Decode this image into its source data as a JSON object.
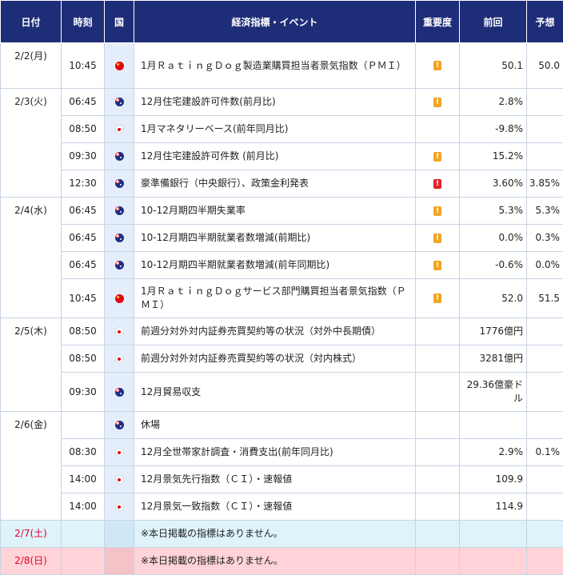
{
  "headers": {
    "date": "日付",
    "time": "時刻",
    "country": "国",
    "event": "経済指標・イベント",
    "importance": "重要度",
    "previous": "前回",
    "forecast": "予想"
  },
  "importance_mark": "!",
  "colors": {
    "header_bg": "#1e2d77",
    "saturday_bg": "#dff3fb",
    "sunday_bg": "#ffd3d7",
    "weekend_text": "#e0002a",
    "importance_mid": "#f2a423",
    "importance_high": "#e0222b"
  },
  "days": [
    {
      "date": "2/2(月)",
      "rows": [
        {
          "time": "10:45",
          "flag": "cn-flag-icon",
          "event": "1月ＲａｔｉｎｇＤｏｇ製造業購買担当者景気指数（ＰＭＩ）",
          "importance": "mid",
          "previous": "50.1",
          "forecast": "50.0",
          "tall": true
        }
      ]
    },
    {
      "date": "2/3(火)",
      "rows": [
        {
          "time": "06:45",
          "flag": "au-flag-icon",
          "event": "12月住宅建設許可件数(前月比)",
          "importance": "mid",
          "previous": "2.8%",
          "forecast": ""
        },
        {
          "time": "08:50",
          "flag": "jp-flag-icon",
          "event": "1月マネタリーベース(前年同月比)",
          "importance": "",
          "previous": "-9.8%",
          "forecast": ""
        },
        {
          "time": "09:30",
          "flag": "au-flag-icon",
          "event": "12月住宅建設許可件数 (前月比)",
          "importance": "mid",
          "previous": "15.2%",
          "forecast": ""
        },
        {
          "time": "12:30",
          "flag": "au-flag-icon",
          "event": "豪準備銀行（中央銀行）、政策金利発表",
          "importance": "high",
          "previous": "3.60%",
          "forecast": "3.85%"
        }
      ]
    },
    {
      "date": "2/4(水)",
      "rows": [
        {
          "time": "06:45",
          "flag": "au-flag-icon",
          "event": "10-12月期四半期失業率",
          "importance": "mid",
          "previous": "5.3%",
          "forecast": "5.3%"
        },
        {
          "time": "06:45",
          "flag": "au-flag-icon",
          "event": "10-12月期四半期就業者数増減(前期比)",
          "importance": "mid",
          "previous": "0.0%",
          "forecast": "0.3%"
        },
        {
          "time": "06:45",
          "flag": "au-flag-icon",
          "event": "10-12月期四半期就業者数増減(前年同期比)",
          "importance": "mid",
          "previous": "-0.6%",
          "forecast": "0.0%"
        },
        {
          "time": "10:45",
          "flag": "cn-flag-icon",
          "event": "1月ＲａｔｉｎｇＤｏｇサービス部門購買担当者景気指数（ＰＭＩ）",
          "importance": "mid",
          "previous": "52.0",
          "forecast": "51.5",
          "tall": true
        }
      ]
    },
    {
      "date": "2/5(木)",
      "rows": [
        {
          "time": "08:50",
          "flag": "jp-flag-icon",
          "event": "前週分対外対内証券売買契約等の状況（対外中長期債）",
          "importance": "",
          "previous": "1776億円",
          "forecast": ""
        },
        {
          "time": "08:50",
          "flag": "jp-flag-icon",
          "event": "前週分対外対内証券売買契約等の状況（対内株式）",
          "importance": "",
          "previous": "3281億円",
          "forecast": ""
        },
        {
          "time": "09:30",
          "flag": "au-flag-icon",
          "event": "12月貿易収支",
          "importance": "",
          "previous": "29.36億豪ドル",
          "forecast": "",
          "tall": true
        }
      ]
    },
    {
      "date": "2/6(金)",
      "rows": [
        {
          "time": "",
          "flag": "au-flag-icon",
          "event": "休場",
          "importance": "",
          "previous": "",
          "forecast": ""
        },
        {
          "time": "08:30",
          "flag": "jp-flag-icon",
          "event": "12月全世帯家計調査・消費支出(前年同月比)",
          "importance": "",
          "previous": "2.9%",
          "forecast": "0.1%"
        },
        {
          "time": "14:00",
          "flag": "jp-flag-icon",
          "event": "12月景気先行指数（ＣＩ）・速報値",
          "importance": "",
          "previous": "109.9",
          "forecast": ""
        },
        {
          "time": "14:00",
          "flag": "jp-flag-icon",
          "event": "12月景気一致指数（ＣＩ）・速報値",
          "importance": "",
          "previous": "114.9",
          "forecast": ""
        }
      ]
    },
    {
      "date": "2/7(土)",
      "weekend": "sat",
      "rows": [
        {
          "time": "",
          "flag": "",
          "event": "※本日掲載の指標はありません。",
          "importance": "",
          "previous": "",
          "forecast": ""
        }
      ]
    },
    {
      "date": "2/8(日)",
      "weekend": "sun",
      "rows": [
        {
          "time": "",
          "flag": "",
          "event": "※本日掲載の指標はありません。",
          "importance": "",
          "previous": "",
          "forecast": ""
        }
      ]
    }
  ]
}
